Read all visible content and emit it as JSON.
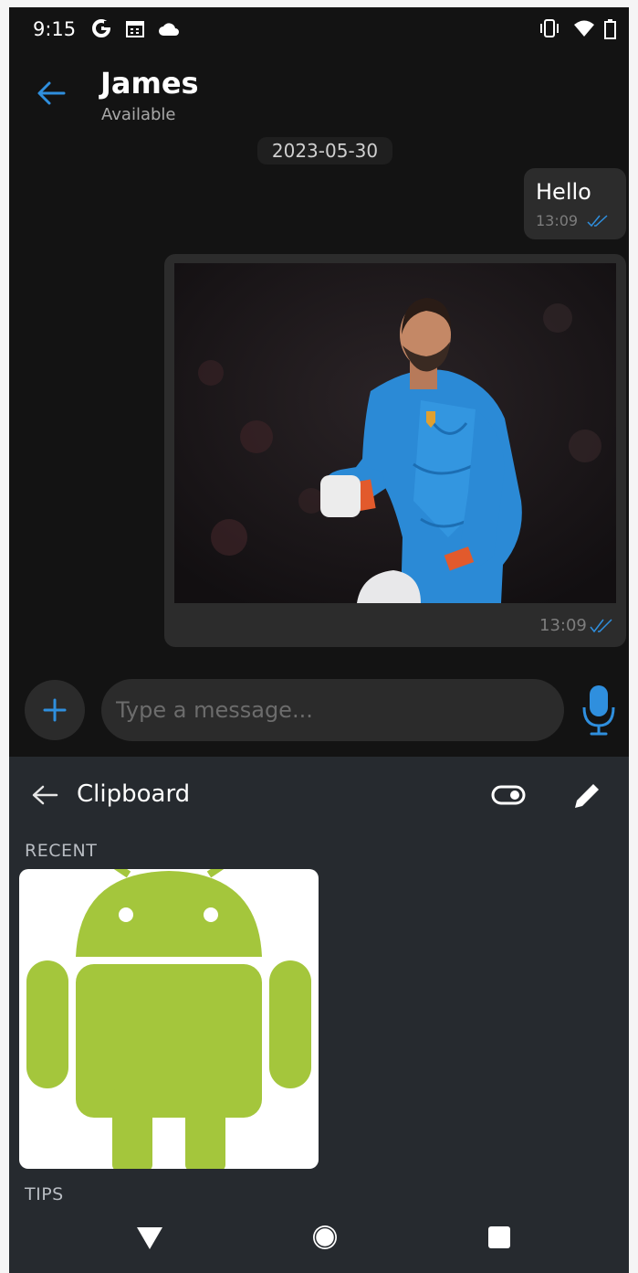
{
  "status_bar": {
    "time": "9:15",
    "icons": [
      "g-icon",
      "calendar-icon",
      "cloud-icon",
      "vibrate-icon",
      "wifi-icon",
      "battery-icon"
    ]
  },
  "chat": {
    "contact_name": "James",
    "contact_status": "Available",
    "date_chip": "2023-05-30",
    "messages": [
      {
        "type": "text",
        "text": "Hello",
        "time": "13:09",
        "status": "read"
      },
      {
        "type": "image",
        "time": "13:09",
        "status": "read"
      }
    ]
  },
  "composer": {
    "placeholder": "Type a message..."
  },
  "keyboard": {
    "title": "Clipboard",
    "recent_label": "RECENT",
    "tips_label": "TIPS"
  },
  "colors": {
    "accent": "#2f8fde",
    "background": "#131313",
    "bubble": "#2c2c2c",
    "keyboard_bg": "#262a2f",
    "android_green": "#a4c63c"
  }
}
